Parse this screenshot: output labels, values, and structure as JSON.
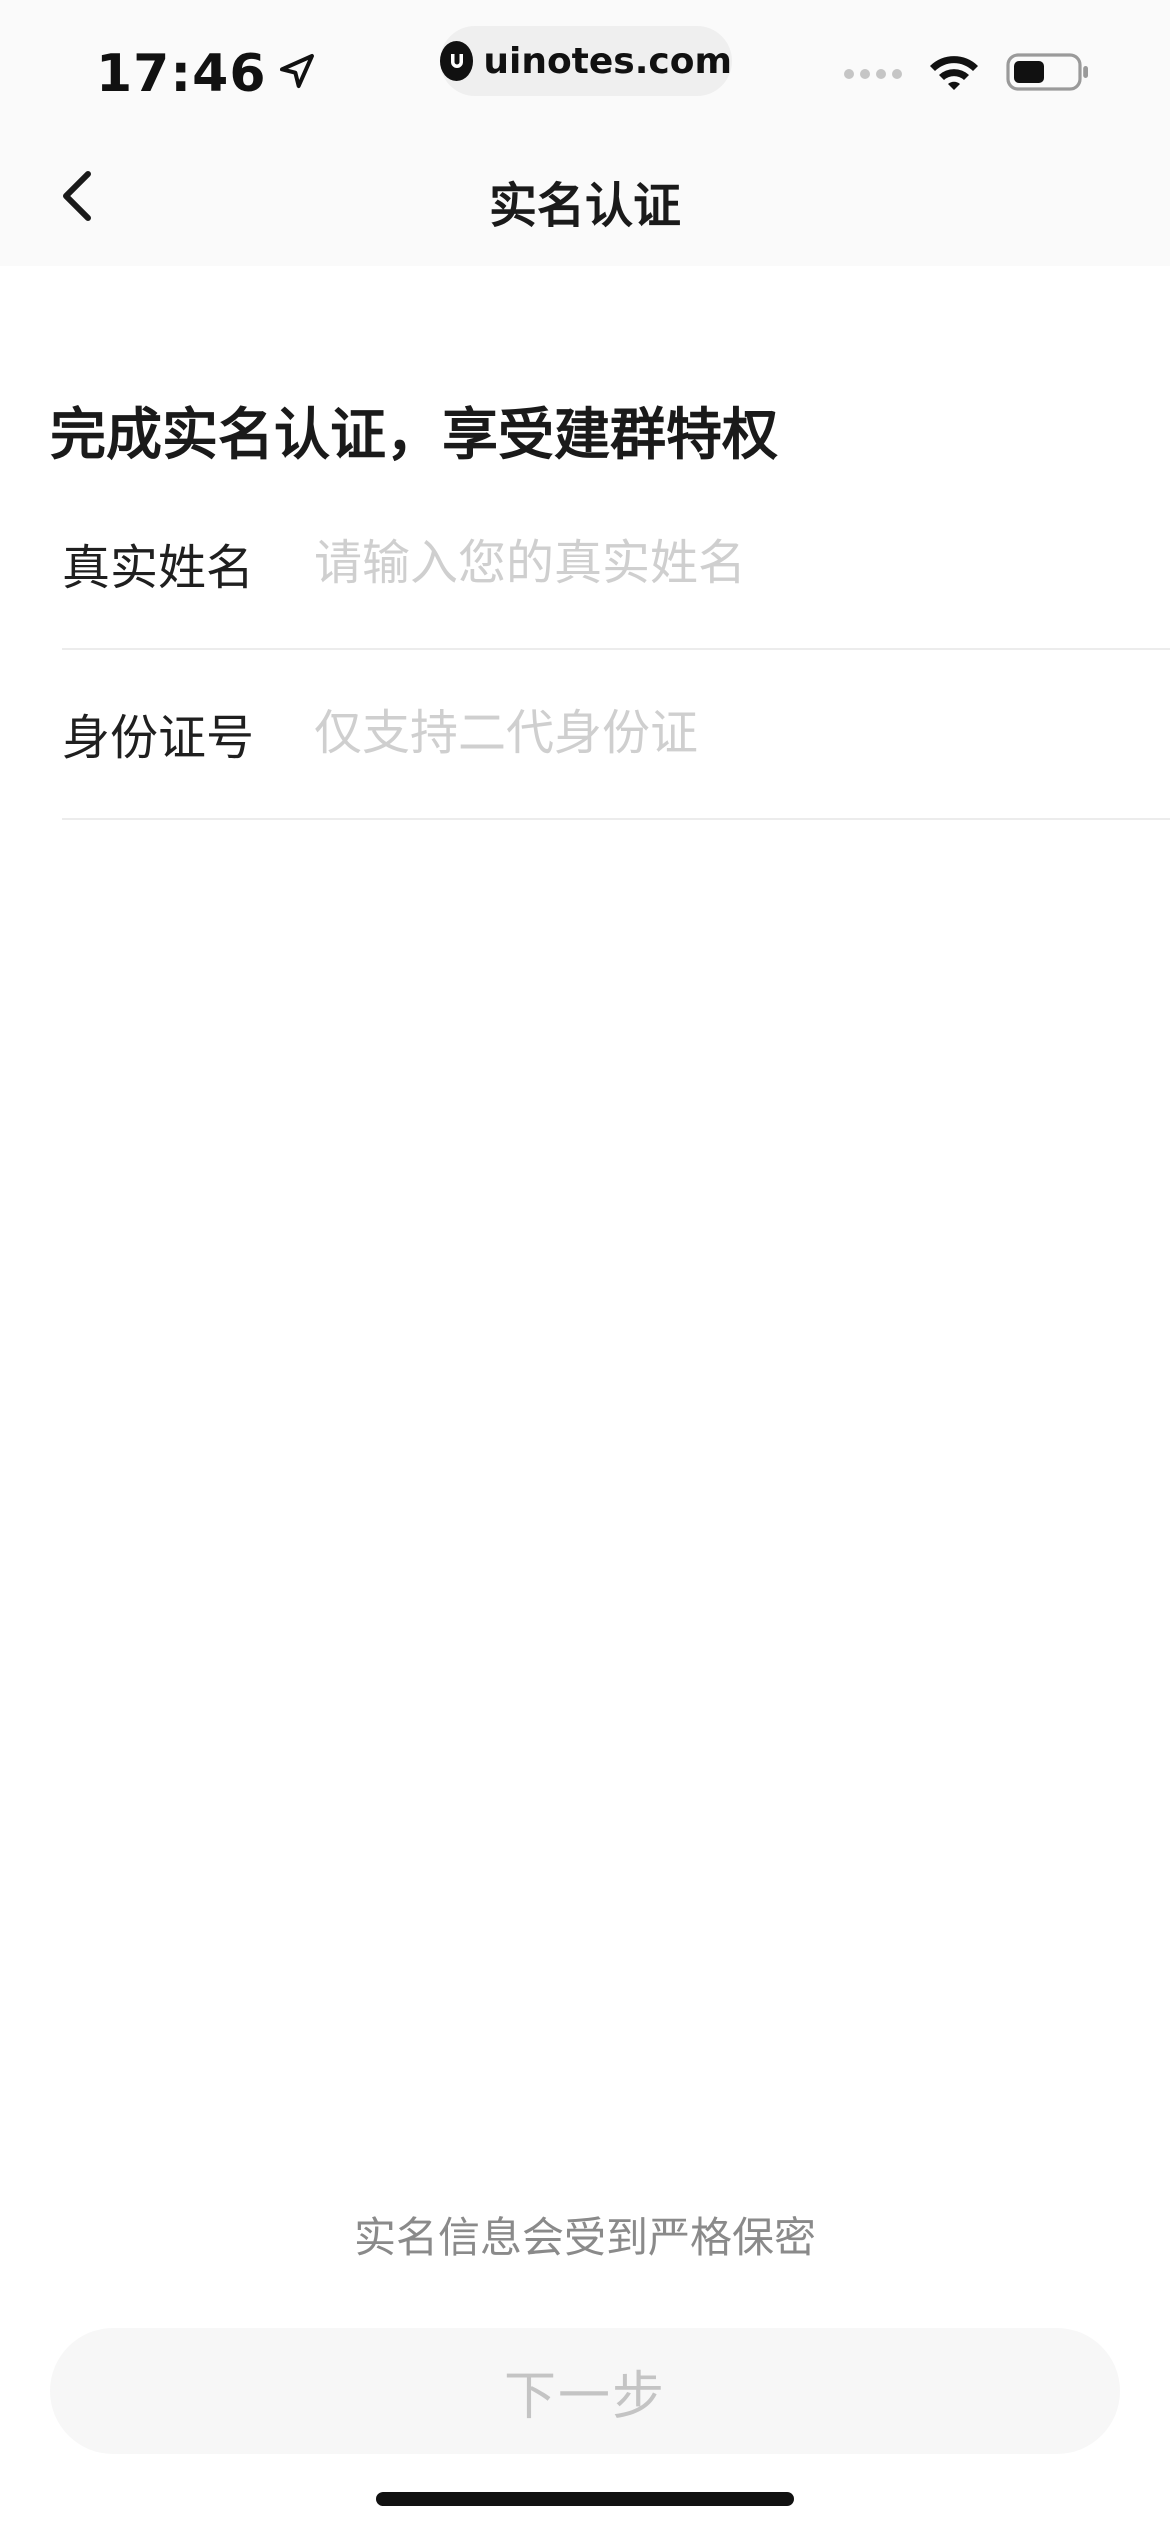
{
  "status_bar": {
    "time": "17:46",
    "url": "uinotes.com"
  },
  "nav": {
    "title": "实名认证"
  },
  "main": {
    "headline": "完成实名认证，享受建群特权",
    "fields": [
      {
        "label": "真实姓名",
        "value": "",
        "placeholder": "请输入您的真实姓名"
      },
      {
        "label": "身份证号",
        "value": "",
        "placeholder": "仅支持二代身份证"
      }
    ],
    "privacy_note": "实名信息会受到严格保密",
    "next_label": "下一步"
  },
  "colors": {
    "background": "#ffffff",
    "header_background": "#fafafa",
    "placeholder_text": "#cfcfcf",
    "disabled_button_bg": "#f7f7f7",
    "disabled_button_text": "#c4c4c4"
  },
  "icons": {
    "back": "chevron-left-icon",
    "location": "location-arrow-icon",
    "wifi": "wifi-icon",
    "battery": "battery-icon",
    "signal": "signal-icon"
  }
}
